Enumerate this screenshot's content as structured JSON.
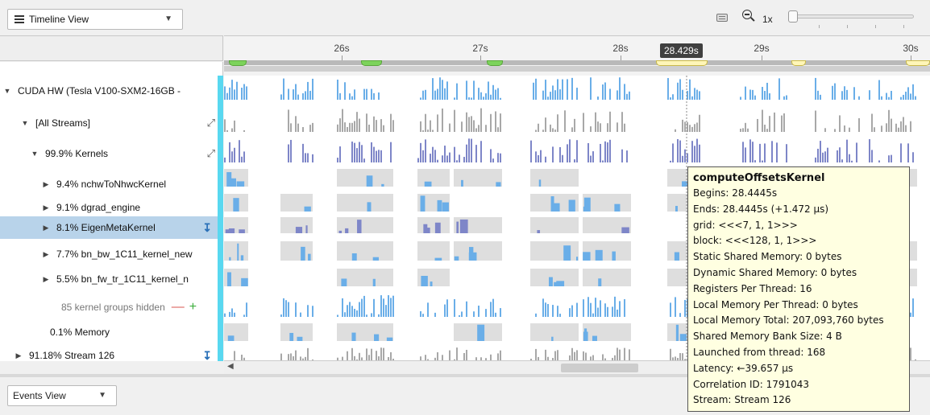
{
  "toolbar": {
    "view_select": "Timeline View",
    "zoom_level": "1x"
  },
  "ruler": {
    "time_labels": [
      "26s",
      "27s",
      "28s",
      "29s",
      "30s"
    ],
    "cursor_time": "28.429s"
  },
  "rows": [
    {
      "label": "CUDA HW (Tesla V100-SXM2-16GB -",
      "expander": "collapsed-down"
    },
    {
      "label": "[All Streams]",
      "expander": "expanded"
    },
    {
      "label": "99.9% Kernels",
      "expander": "expanded"
    },
    {
      "label": "9.4% nchwToNhwcKernel",
      "expander": "collapsed"
    },
    {
      "label": "9.1% dgrad_engine",
      "expander": "collapsed"
    },
    {
      "label": "8.1% EigenMetaKernel",
      "expander": "collapsed",
      "selected": true
    },
    {
      "label": "7.7% bn_bw_1C11_kernel_new",
      "expander": "collapsed"
    },
    {
      "label": "5.5% bn_fw_tr_1C11_kernel_n",
      "expander": "collapsed"
    },
    {
      "label": "85 kernel groups hidden",
      "expander": "none"
    },
    {
      "label": "0.1% Memory",
      "expander": "none"
    },
    {
      "label": "91.18% Stream 126",
      "expander": "collapsed"
    }
  ],
  "colors": {
    "kernel_blue": "#6aaee8",
    "gray_bar": "#a8a8a8",
    "violet_bar": "#7e86c8",
    "light_block": "#dedede",
    "selected_row": "#b8d3ea",
    "accent_cyan": "#59d8f0"
  },
  "events_view": {
    "select": "Events View"
  },
  "tooltip": {
    "title": "computeOffsetsKernel",
    "lines": [
      "Begins: 28.4445s",
      "Ends: 28.4445s (+1.472 µs)",
      "grid:  <<<7, 1, 1>>>",
      "block: <<<128, 1, 1>>>",
      "Static Shared Memory: 0 bytes",
      "Dynamic Shared Memory: 0 bytes",
      "Registers Per Thread: 16",
      "Local Memory Per Thread: 0 bytes",
      "Local Memory Total: 207,093,760 bytes",
      "Shared Memory Bank Size: 4 B",
      "Launched from thread: 168",
      "Latency: ←39.657 µs",
      "Correlation ID: 1791043",
      "Stream: Stream 126"
    ]
  }
}
